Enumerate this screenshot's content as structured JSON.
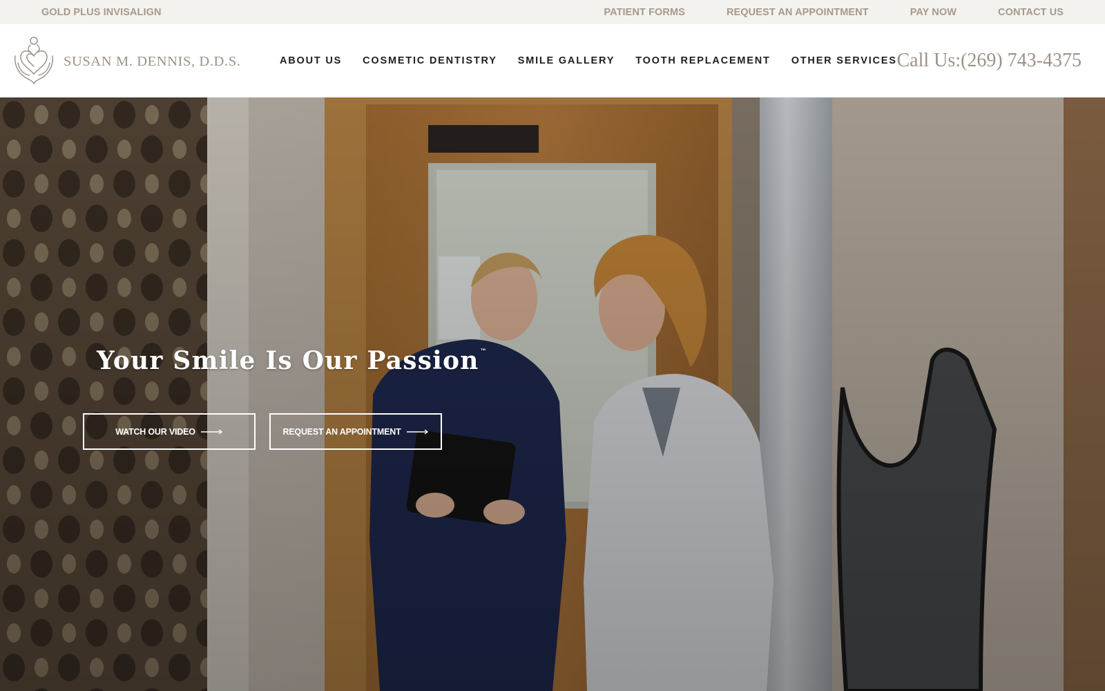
{
  "utility_bar": {
    "left_link": "GOLD PLUS INVISALIGN",
    "right_links": [
      "PATIENT FORMS",
      "REQUEST AN APPOINTMENT",
      "PAY NOW",
      "CONTACT US"
    ],
    "text_color": "#a6998a",
    "background": "#f3f2ef"
  },
  "header": {
    "logo_text": "SUSAN M. DENNIS, D.D.S.",
    "logo_icon": "heart-hands-logo-icon",
    "nav": [
      "ABOUT US",
      "COSMETIC DENTISTRY",
      "SMILE GALLERY",
      "TOOTH REPLACEMENT",
      "OTHER SERVICES"
    ],
    "call_us": "Call Us:(269) 743-4375",
    "accent_color": "#9c9288"
  },
  "hero": {
    "title": "Your Smile Is Our Passion",
    "trademark": "™",
    "buttons": [
      {
        "label": "WATCH OUR VIDEO",
        "icon": "arrow-right-icon"
      },
      {
        "label": "REQUEST AN APPOINTMENT",
        "icon": "arrow-right-icon"
      }
    ],
    "background_image": "dental office hallway photo"
  }
}
